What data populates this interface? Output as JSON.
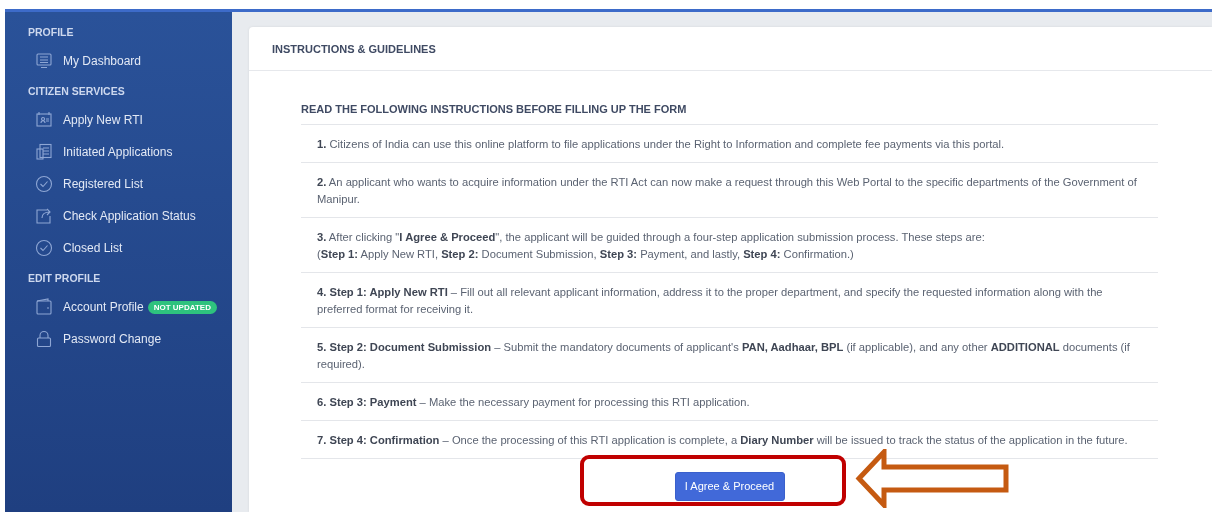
{
  "sidebar": {
    "sections": [
      {
        "heading": "PROFILE",
        "items": [
          {
            "label": "My Dashboard"
          }
        ]
      },
      {
        "heading": "CITIZEN SERVICES",
        "items": [
          {
            "label": "Apply New RTI"
          },
          {
            "label": "Initiated Applications"
          },
          {
            "label": "Registered List"
          },
          {
            "label": "Check Application Status"
          },
          {
            "label": "Closed List"
          }
        ]
      },
      {
        "heading": "EDIT PROFILE",
        "items": [
          {
            "label": "Account Profile",
            "badge": "NOT UPDATED"
          },
          {
            "label": "Password Change"
          }
        ]
      }
    ]
  },
  "card": {
    "title": "INSTRUCTIONS & GUIDELINES",
    "heading": "READ THE FOLLOWING INSTRUCTIONS BEFORE FILLING UP THE FORM",
    "instructions": [
      {
        "lines": [
          "**1.** Citizens of India can use this online platform to file applications under the Right to Information and complete fee payments via this portal."
        ]
      },
      {
        "lines": [
          "**2.** An applicant who wants to acquire information under the RTI Act can now make a request through this Web Portal to the specific departments of the Government of Manipur."
        ]
      },
      {
        "lines": [
          "**3.** After clicking \"**I Agree & Proceed**\", the applicant will be guided through a four-step application submission process. These steps are:",
          "(**Step 1:** Apply New RTI, **Step 2:** Document Submission, **Step 3:** Payment, and lastly, **Step 4:** Confirmation.)"
        ]
      },
      {
        "lines": [
          "**4. Step 1: Apply New RTI** – Fill out all relevant applicant information, address it to the proper department, and specify the requested information along with the preferred format for receiving it."
        ]
      },
      {
        "lines": [
          "**5. Step 2: Document Submission** – Submit the mandatory documents of applicant's **PAN, Aadhaar, BPL** (if applicable), and any other **ADDITIONAL** documents (if required)."
        ]
      },
      {
        "lines": [
          "**6. Step 3: Payment** – Make the necessary payment for processing this RTI application."
        ]
      },
      {
        "lines": [
          "**7. Step 4: Confirmation** – Once the processing of this RTI application is complete, a **Diary Number** will be issued to track the status of the application in the future."
        ]
      }
    ],
    "button": "I Agree & Proceed"
  }
}
